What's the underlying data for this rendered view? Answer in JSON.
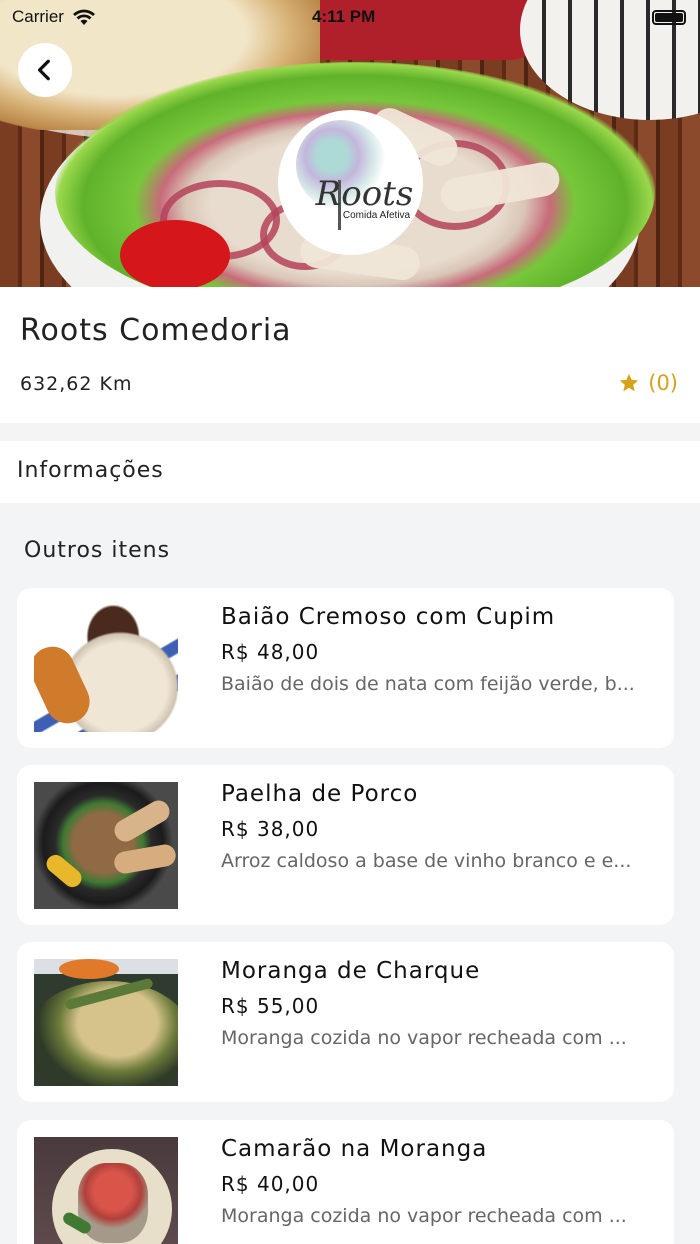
{
  "status_bar": {
    "carrier": "Carrier",
    "time": "4:11 PM"
  },
  "store": {
    "logo_text": "Roots",
    "logo_subtitle": "Comida Afetiva",
    "name": "Roots Comedoria",
    "distance": "632,62 Km",
    "rating_count": "(0)",
    "rating_color": "#d4a21b"
  },
  "info": {
    "label": "Informações"
  },
  "other_items": {
    "title": "Outros itens",
    "items": [
      {
        "name": "Baião Cremoso com Cupim",
        "price": "R$ 48,00",
        "description": "Baião de dois de nata com feijão verde, b..."
      },
      {
        "name": "Paelha de Porco",
        "price": "R$ 38,00",
        "description": "Arroz caldoso a base de vinho branco e e..."
      },
      {
        "name": "Moranga de Charque",
        "price": "R$ 55,00",
        "description": "Moranga cozida no vapor recheada com ..."
      },
      {
        "name": "Camarão na Moranga",
        "price": "R$ 40,00",
        "description": "Moranga cozida no vapor recheada com ..."
      }
    ]
  },
  "icons": {
    "back": "chevron-left-icon",
    "star": "star-icon",
    "wifi": "wifi-icon",
    "battery": "battery-icon"
  }
}
